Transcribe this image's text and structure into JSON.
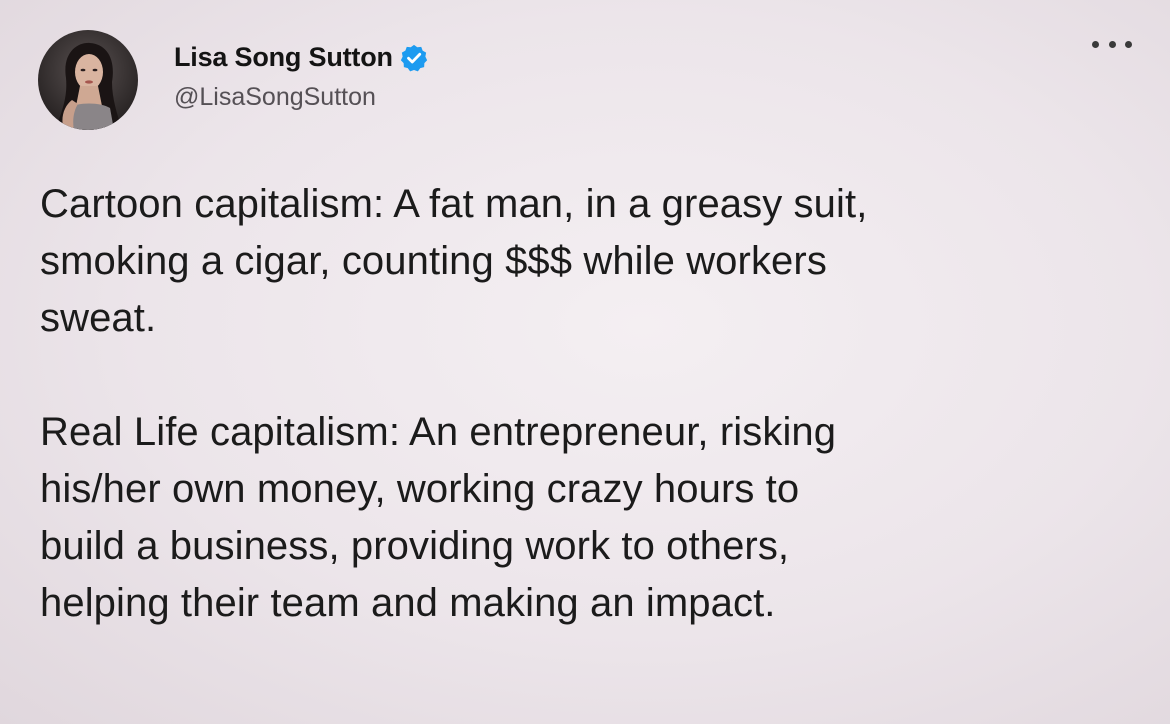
{
  "tweet": {
    "author": {
      "display_name": "Lisa Song Sutton",
      "handle": "@LisaSongSutton",
      "verified": true,
      "avatar_icon": "profile-photo-avatar",
      "verified_icon": "verified-badge-icon",
      "verified_color": "#1d9bf0"
    },
    "more_icon": "more-options-icon",
    "paragraphs": [
      {
        "lines": [
          "Cartoon capitalism: A fat man, in a greasy suit,",
          "smoking a cigar, counting $$$ while workers",
          "sweat."
        ]
      },
      {
        "lines": [
          "Real Life capitalism: An entrepreneur, risking",
          "his/her own money, working crazy hours to",
          "build a business, providing work to others,",
          "helping their team and making an impact."
        ]
      }
    ]
  }
}
